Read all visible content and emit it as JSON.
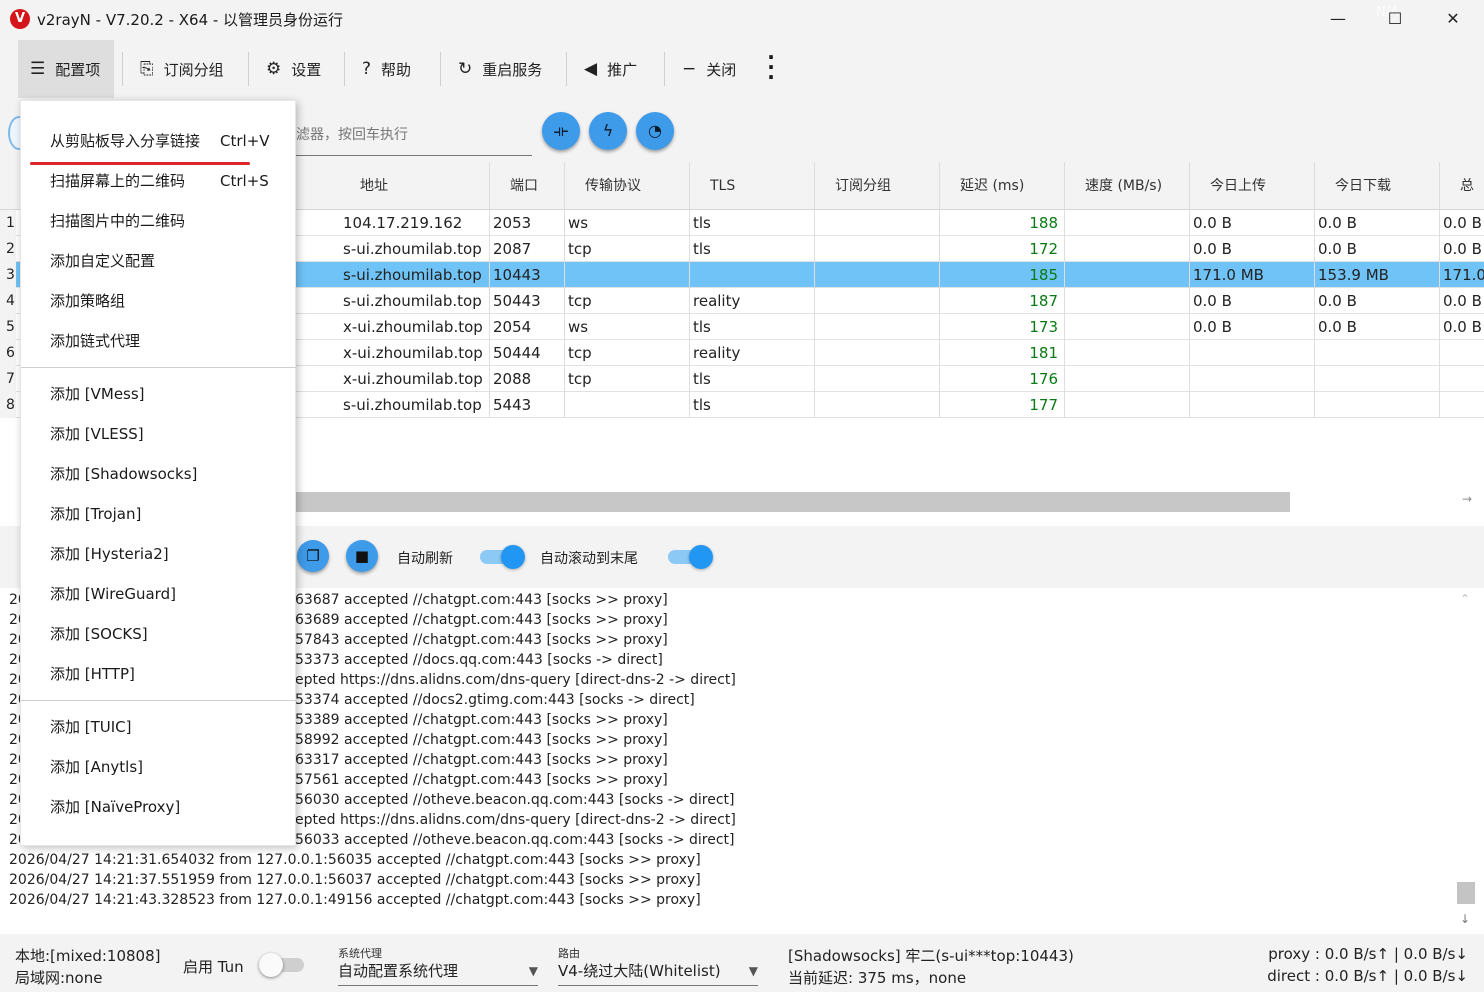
{
  "window": {
    "title": "v2rayN - V7.20.2 - X64 - 以管理员身份运行",
    "app_icon": "v2rayn-logo",
    "controls": [
      "minimize",
      "maximize",
      "close"
    ]
  },
  "toolbar": {
    "items": [
      {
        "label": "配置项",
        "icon": "server-icon",
        "active": true
      },
      {
        "label": "订阅分组",
        "icon": "subscription-icon"
      },
      {
        "label": "设置",
        "icon": "gear-icon"
      },
      {
        "label": "帮助",
        "icon": "help-icon"
      },
      {
        "label": "重启服务",
        "icon": "restart-icon"
      },
      {
        "label": "推广",
        "icon": "speaker-icon"
      },
      {
        "label": "关闭",
        "icon": "minus-icon"
      }
    ]
  },
  "filter": {
    "placeholder": "滤器，按回车执行"
  },
  "grid": {
    "headers": [
      "地址",
      "端口",
      "传输协议",
      "TLS",
      "订阅分组",
      "延迟 (ms)",
      "速度 (MB/s)",
      "今日上传",
      "今日下载",
      "总"
    ],
    "rows": [
      {
        "num": "1",
        "addr": "104.17.219.162",
        "port": "2053",
        "net": "ws",
        "tls": "tls",
        "sub": "",
        "delay": "188",
        "speed": "",
        "up": "0.0 B",
        "down": "0.0 B",
        "total": "0.0 B"
      },
      {
        "num": "2",
        "addr": "s-ui.zhoumilab.top",
        "port": "2087",
        "net": "tcp",
        "tls": "tls",
        "sub": "",
        "delay": "172",
        "speed": "",
        "up": "0.0 B",
        "down": "0.0 B",
        "total": "0.0 B"
      },
      {
        "num": "3",
        "addr": "s-ui.zhoumilab.top",
        "port": "10443",
        "net": "",
        "tls": "",
        "sub": "",
        "delay": "185",
        "speed": "",
        "up": "171.0 MB",
        "down": "153.9 MB",
        "total": "171.0"
      },
      {
        "num": "4",
        "addr": "s-ui.zhoumilab.top",
        "port": "50443",
        "net": "tcp",
        "tls": "reality",
        "sub": "",
        "delay": "187",
        "speed": "",
        "up": "0.0 B",
        "down": "0.0 B",
        "total": "0.0 B"
      },
      {
        "num": "5",
        "addr": "x-ui.zhoumilab.top",
        "port": "2054",
        "net": "ws",
        "tls": "tls",
        "sub": "",
        "delay": "173",
        "speed": "",
        "up": "0.0 B",
        "down": "0.0 B",
        "total": "0.0 B"
      },
      {
        "num": "6",
        "addr": "x-ui.zhoumilab.top",
        "port": "50444",
        "net": "tcp",
        "tls": "reality",
        "sub": "",
        "delay": "181",
        "speed": "",
        "up": "",
        "down": "",
        "total": ""
      },
      {
        "num": "7",
        "addr": "x-ui.zhoumilab.top",
        "port": "2088",
        "net": "tcp",
        "tls": "tls",
        "sub": "",
        "delay": "176",
        "speed": "",
        "up": "",
        "down": "",
        "total": ""
      },
      {
        "num": "8",
        "addr": "s-ui.zhoumilab.top",
        "port": "5443",
        "net": "",
        "tls": "tls",
        "sub": "",
        "delay": "177",
        "speed": "",
        "up": "",
        "down": "",
        "total": ""
      }
    ],
    "selected_row": 2
  },
  "log_toolbar": {
    "auto_refresh_label": "自动刷新",
    "auto_refresh_on": true,
    "auto_scroll_label": "自动滚动到末尾",
    "auto_scroll_on": true
  },
  "log": {
    "partial_lines": [
      {
        "prefix": "20",
        "text": "63687 accepted //chatgpt.com:443 [socks >> proxy]"
      },
      {
        "prefix": "20",
        "text": "63689 accepted //chatgpt.com:443 [socks >> proxy]"
      },
      {
        "prefix": "20",
        "text": "57843 accepted //chatgpt.com:443 [socks >> proxy]"
      },
      {
        "prefix": "20",
        "text": "53373 accepted //docs.qq.com:443 [socks -> direct]"
      },
      {
        "prefix": "20",
        "text": "epted https://dns.alidns.com/dns-query [direct-dns-2 -> direct]"
      },
      {
        "prefix": "20",
        "text": "53374 accepted //docs2.gtimg.com:443 [socks -> direct]"
      },
      {
        "prefix": "20",
        "text": "53389 accepted //chatgpt.com:443 [socks >> proxy]"
      },
      {
        "prefix": "20",
        "text": "58992 accepted //chatgpt.com:443 [socks >> proxy]"
      },
      {
        "prefix": "20",
        "text": "63317 accepted //chatgpt.com:443 [socks >> proxy]"
      },
      {
        "prefix": "20",
        "text": "57561 accepted //chatgpt.com:443 [socks >> proxy]"
      },
      {
        "prefix": "20",
        "text": "56030 accepted //otheve.beacon.qq.com:443 [socks -> direct]"
      },
      {
        "prefix": "20",
        "text": "epted https://dns.alidns.com/dns-query [direct-dns-2 -> direct]"
      },
      {
        "prefix": "20",
        "text": "56033 accepted //otheve.beacon.qq.com:443 [socks -> direct]"
      }
    ],
    "full_lines": [
      "2026/04/27 14:21:31.654032 from 127.0.0.1:56035 accepted //chatgpt.com:443 [socks >> proxy]",
      "2026/04/27 14:21:37.551959 from 127.0.0.1:56037 accepted //chatgpt.com:443 [socks >> proxy]",
      "2026/04/27 14:21:43.328523 from 127.0.0.1:49156 accepted //chatgpt.com:443 [socks >> proxy]"
    ]
  },
  "statusbar": {
    "local": "本地:[mixed:10808]",
    "lan": "局域网:none",
    "tun_label": "启用 Tun",
    "tun_on": false,
    "sysproxy_caption": "系统代理",
    "sysproxy_value": "自动配置系统代理",
    "route_caption": "路由",
    "route_value": "V4-绕过大陆(Whitelist)",
    "current_server": "[Shadowsocks] 牢二(s-ui***top:10443)",
    "current_delay": "当前延迟: 375 ms，none",
    "proxy_speed": "proxy : 0.0 B/s↑ | 0.0 B/s↓",
    "direct_speed": "direct : 0.0 B/s↑ | 0.0 B/s↓"
  },
  "menu": {
    "groups": [
      [
        {
          "label": "从剪贴板导入分享链接",
          "shortcut": "Ctrl+V"
        },
        {
          "label": "扫描屏幕上的二维码",
          "shortcut": "Ctrl+S"
        },
        {
          "label": "扫描图片中的二维码",
          "shortcut": ""
        },
        {
          "label": "添加自定义配置",
          "shortcut": ""
        },
        {
          "label": "添加策略组",
          "shortcut": ""
        },
        {
          "label": "添加链式代理",
          "shortcut": ""
        }
      ],
      [
        {
          "label": "添加 [VMess]",
          "shortcut": ""
        },
        {
          "label": "添加 [VLESS]",
          "shortcut": ""
        },
        {
          "label": "添加 [Shadowsocks]",
          "shortcut": ""
        },
        {
          "label": "添加 [Trojan]",
          "shortcut": ""
        },
        {
          "label": "添加 [Hysteria2]",
          "shortcut": ""
        },
        {
          "label": "添加 [WireGuard]",
          "shortcut": ""
        },
        {
          "label": "添加 [SOCKS]",
          "shortcut": ""
        },
        {
          "label": "添加 [HTTP]",
          "shortcut": ""
        }
      ],
      [
        {
          "label": "添加 [TUIC]",
          "shortcut": ""
        },
        {
          "label": "添加 [Anytls]",
          "shortcut": ""
        },
        {
          "label": "添加 [NaïveProxy]",
          "shortcut": ""
        }
      ]
    ],
    "highlight_color": "#e0242b"
  },
  "colors": {
    "accent": "#2196f3",
    "selected_row": "#70c3f7",
    "latency_text": "#0a7a14"
  }
}
